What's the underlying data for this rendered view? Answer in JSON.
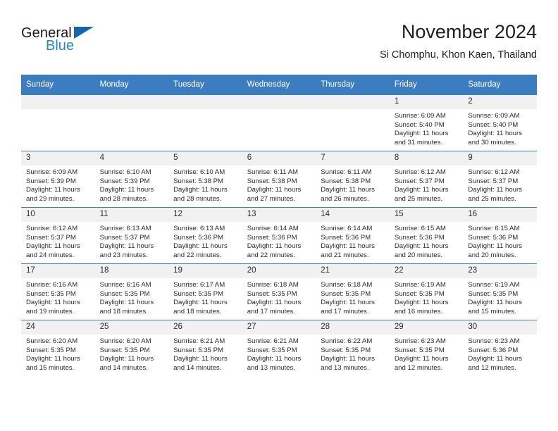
{
  "brand": {
    "name_part1": "General",
    "name_part2": "Blue",
    "triangle_color": "#1266ab",
    "blue_color": "#2487d1"
  },
  "header": {
    "title": "November 2024",
    "location": "Si Chomphu, Khon Kaen, Thailand"
  },
  "theme": {
    "header_blue": "#3b7dc0",
    "daynum_band": "#f1f1f1",
    "text": "#2b2b2b"
  },
  "weekday_headers": [
    "Sunday",
    "Monday",
    "Tuesday",
    "Wednesday",
    "Thursday",
    "Friday",
    "Saturday"
  ],
  "labels": {
    "sunrise_prefix": "Sunrise:",
    "sunset_prefix": "Sunset:",
    "daylight_prefix": "Daylight:"
  },
  "weeks": [
    [
      {
        "day": "",
        "blank": true
      },
      {
        "day": "",
        "blank": true
      },
      {
        "day": "",
        "blank": true
      },
      {
        "day": "",
        "blank": true
      },
      {
        "day": "",
        "blank": true
      },
      {
        "day": "1",
        "sunrise": "Sunrise: 6:09 AM",
        "sunset": "Sunset: 5:40 PM",
        "daylight_line1": "Daylight: 11 hours",
        "daylight_line2": "and 31 minutes."
      },
      {
        "day": "2",
        "sunrise": "Sunrise: 6:09 AM",
        "sunset": "Sunset: 5:40 PM",
        "daylight_line1": "Daylight: 11 hours",
        "daylight_line2": "and 30 minutes."
      }
    ],
    [
      {
        "day": "3",
        "sunrise": "Sunrise: 6:09 AM",
        "sunset": "Sunset: 5:39 PM",
        "daylight_line1": "Daylight: 11 hours",
        "daylight_line2": "and 29 minutes."
      },
      {
        "day": "4",
        "sunrise": "Sunrise: 6:10 AM",
        "sunset": "Sunset: 5:39 PM",
        "daylight_line1": "Daylight: 11 hours",
        "daylight_line2": "and 28 minutes."
      },
      {
        "day": "5",
        "sunrise": "Sunrise: 6:10 AM",
        "sunset": "Sunset: 5:38 PM",
        "daylight_line1": "Daylight: 11 hours",
        "daylight_line2": "and 28 minutes."
      },
      {
        "day": "6",
        "sunrise": "Sunrise: 6:11 AM",
        "sunset": "Sunset: 5:38 PM",
        "daylight_line1": "Daylight: 11 hours",
        "daylight_line2": "and 27 minutes."
      },
      {
        "day": "7",
        "sunrise": "Sunrise: 6:11 AM",
        "sunset": "Sunset: 5:38 PM",
        "daylight_line1": "Daylight: 11 hours",
        "daylight_line2": "and 26 minutes."
      },
      {
        "day": "8",
        "sunrise": "Sunrise: 6:12 AM",
        "sunset": "Sunset: 5:37 PM",
        "daylight_line1": "Daylight: 11 hours",
        "daylight_line2": "and 25 minutes."
      },
      {
        "day": "9",
        "sunrise": "Sunrise: 6:12 AM",
        "sunset": "Sunset: 5:37 PM",
        "daylight_line1": "Daylight: 11 hours",
        "daylight_line2": "and 25 minutes."
      }
    ],
    [
      {
        "day": "10",
        "sunrise": "Sunrise: 6:12 AM",
        "sunset": "Sunset: 5:37 PM",
        "daylight_line1": "Daylight: 11 hours",
        "daylight_line2": "and 24 minutes."
      },
      {
        "day": "11",
        "sunrise": "Sunrise: 6:13 AM",
        "sunset": "Sunset: 5:37 PM",
        "daylight_line1": "Daylight: 11 hours",
        "daylight_line2": "and 23 minutes."
      },
      {
        "day": "12",
        "sunrise": "Sunrise: 6:13 AM",
        "sunset": "Sunset: 5:36 PM",
        "daylight_line1": "Daylight: 11 hours",
        "daylight_line2": "and 22 minutes."
      },
      {
        "day": "13",
        "sunrise": "Sunrise: 6:14 AM",
        "sunset": "Sunset: 5:36 PM",
        "daylight_line1": "Daylight: 11 hours",
        "daylight_line2": "and 22 minutes."
      },
      {
        "day": "14",
        "sunrise": "Sunrise: 6:14 AM",
        "sunset": "Sunset: 5:36 PM",
        "daylight_line1": "Daylight: 11 hours",
        "daylight_line2": "and 21 minutes."
      },
      {
        "day": "15",
        "sunrise": "Sunrise: 6:15 AM",
        "sunset": "Sunset: 5:36 PM",
        "daylight_line1": "Daylight: 11 hours",
        "daylight_line2": "and 20 minutes."
      },
      {
        "day": "16",
        "sunrise": "Sunrise: 6:15 AM",
        "sunset": "Sunset: 5:36 PM",
        "daylight_line1": "Daylight: 11 hours",
        "daylight_line2": "and 20 minutes."
      }
    ],
    [
      {
        "day": "17",
        "sunrise": "Sunrise: 6:16 AM",
        "sunset": "Sunset: 5:35 PM",
        "daylight_line1": "Daylight: 11 hours",
        "daylight_line2": "and 19 minutes."
      },
      {
        "day": "18",
        "sunrise": "Sunrise: 6:16 AM",
        "sunset": "Sunset: 5:35 PM",
        "daylight_line1": "Daylight: 11 hours",
        "daylight_line2": "and 18 minutes."
      },
      {
        "day": "19",
        "sunrise": "Sunrise: 6:17 AM",
        "sunset": "Sunset: 5:35 PM",
        "daylight_line1": "Daylight: 11 hours",
        "daylight_line2": "and 18 minutes."
      },
      {
        "day": "20",
        "sunrise": "Sunrise: 6:18 AM",
        "sunset": "Sunset: 5:35 PM",
        "daylight_line1": "Daylight: 11 hours",
        "daylight_line2": "and 17 minutes."
      },
      {
        "day": "21",
        "sunrise": "Sunrise: 6:18 AM",
        "sunset": "Sunset: 5:35 PM",
        "daylight_line1": "Daylight: 11 hours",
        "daylight_line2": "and 17 minutes."
      },
      {
        "day": "22",
        "sunrise": "Sunrise: 6:19 AM",
        "sunset": "Sunset: 5:35 PM",
        "daylight_line1": "Daylight: 11 hours",
        "daylight_line2": "and 16 minutes."
      },
      {
        "day": "23",
        "sunrise": "Sunrise: 6:19 AM",
        "sunset": "Sunset: 5:35 PM",
        "daylight_line1": "Daylight: 11 hours",
        "daylight_line2": "and 15 minutes."
      }
    ],
    [
      {
        "day": "24",
        "sunrise": "Sunrise: 6:20 AM",
        "sunset": "Sunset: 5:35 PM",
        "daylight_line1": "Daylight: 11 hours",
        "daylight_line2": "and 15 minutes."
      },
      {
        "day": "25",
        "sunrise": "Sunrise: 6:20 AM",
        "sunset": "Sunset: 5:35 PM",
        "daylight_line1": "Daylight: 11 hours",
        "daylight_line2": "and 14 minutes."
      },
      {
        "day": "26",
        "sunrise": "Sunrise: 6:21 AM",
        "sunset": "Sunset: 5:35 PM",
        "daylight_line1": "Daylight: 11 hours",
        "daylight_line2": "and 14 minutes."
      },
      {
        "day": "27",
        "sunrise": "Sunrise: 6:21 AM",
        "sunset": "Sunset: 5:35 PM",
        "daylight_line1": "Daylight: 11 hours",
        "daylight_line2": "and 13 minutes."
      },
      {
        "day": "28",
        "sunrise": "Sunrise: 6:22 AM",
        "sunset": "Sunset: 5:35 PM",
        "daylight_line1": "Daylight: 11 hours",
        "daylight_line2": "and 13 minutes."
      },
      {
        "day": "29",
        "sunrise": "Sunrise: 6:23 AM",
        "sunset": "Sunset: 5:35 PM",
        "daylight_line1": "Daylight: 11 hours",
        "daylight_line2": "and 12 minutes."
      },
      {
        "day": "30",
        "sunrise": "Sunrise: 6:23 AM",
        "sunset": "Sunset: 5:36 PM",
        "daylight_line1": "Daylight: 11 hours",
        "daylight_line2": "and 12 minutes."
      }
    ]
  ]
}
